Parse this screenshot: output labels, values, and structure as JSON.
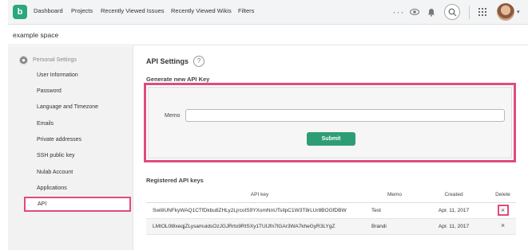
{
  "topnav": {
    "logo_letter": "b",
    "links": [
      "Dashboard",
      "Projects",
      "Recently Viewed Issues",
      "Recently Viewed Wikis",
      "Filters"
    ],
    "more_icon": "ellipsis-icon",
    "watch_icon": "eye-icon",
    "notification_icon": "bell-icon",
    "search_icon": "search-icon",
    "apps_icon": "grid-icon",
    "avatar": "user-avatar"
  },
  "space": {
    "title": "example space"
  },
  "sidebar": {
    "heading": "Personal Settings",
    "items": [
      "User Information",
      "Password",
      "Language and Timezone",
      "Emails",
      "Private addresses",
      "SSH public key",
      "Nulab Account",
      "Applications",
      "API"
    ],
    "active_index": 8
  },
  "main": {
    "title": "API Settings",
    "help_symbol": "?",
    "generate_heading": "Generate new API Key",
    "memo_label": "Memo",
    "memo_value": "",
    "submit_label": "Submit",
    "registered_heading": "Registered API keys",
    "table": {
      "headers": [
        "API key",
        "Memo",
        "Created",
        "Delete"
      ],
      "rows": [
        {
          "key": "SwI8UNFkyWAQ1CTfDkbu8ZHLy2LjrcoIS9YXomNnUTsIlpC1W3T8rLUr8BOGfDBW",
          "memo": "Test",
          "created": "Apr. 11, 2017",
          "delete": "×"
        },
        {
          "key": "LMIOL0t8xeqjZLysamuidsOzJGJRrto9RtSXy1TUIJfn7lGAr3WA7kheGyR3LYgZ",
          "memo": "Brandi",
          "created": "Apr. 11, 2017",
          "delete": "×"
        }
      ]
    }
  },
  "colors": {
    "brand_green": "#2aa77c",
    "submit_green": "#2e9d75",
    "highlight_pink": "#e04b7a"
  }
}
